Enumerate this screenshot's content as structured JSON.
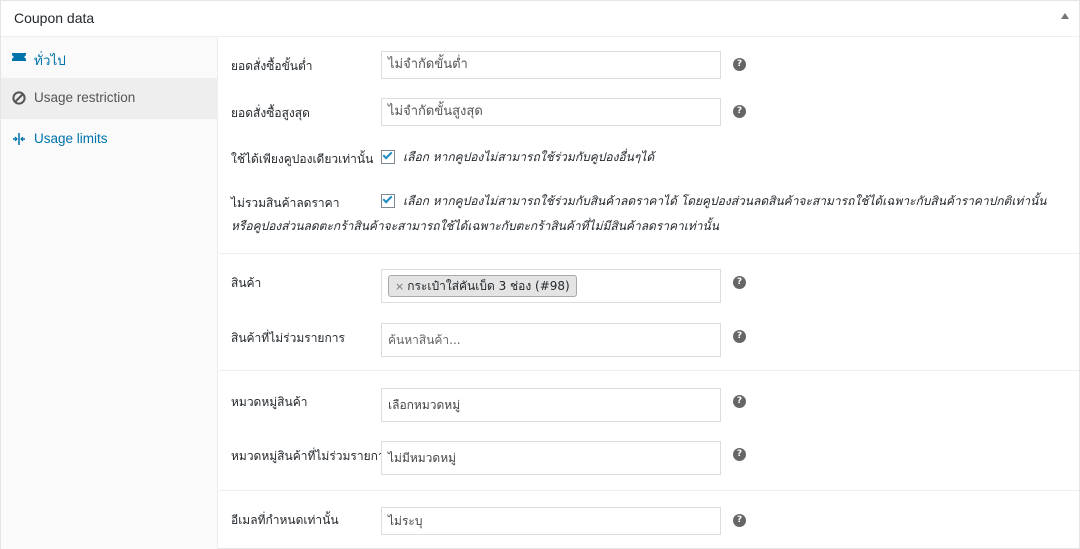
{
  "panel": {
    "title": "Coupon data"
  },
  "tabs": [
    {
      "label": "ทั่วไป",
      "icon": "ticket-icon",
      "active": false
    },
    {
      "label": "Usage restriction",
      "icon": "prohibited-icon",
      "active": true
    },
    {
      "label": "Usage limits",
      "icon": "limits-icon",
      "active": false
    }
  ],
  "fields": {
    "minimum_spend": {
      "label": "ยอดสั่งซื้อขั้นต่ำ",
      "placeholder": "ไม่จำกัดขั้นต่ำ"
    },
    "maximum_spend": {
      "label": "ยอดสั่งซื้อสูงสุด",
      "placeholder": "ไม่จำกัดขั้นสูงสุด"
    },
    "individual_use": {
      "label": "ใช้ได้เพียงคูปองเดียวเท่านั้น",
      "checked": true,
      "description": "เลือก หากคูปองไม่สามารถใช้ร่วมกับคูปองอื่นๆได้"
    },
    "exclude_sale_items": {
      "label": "ไม่รวมสินค้าลดราคา",
      "checked": true,
      "description_line1": "เลือก หากคูปองไม่สามารถใช้ร่วมกับสินค้าลดราคาได้ โดยคูปองส่วนลดสินค้าจะสามารถใช้ได้เฉพาะกับสินค้าราคาปกติเท่านั้น",
      "description_line2": "หรือคูปองส่วนลดตะกร้าสินค้าจะสามารถใช้ได้เฉพาะกับตะกร้าสินค้าที่ไม่มีสินค้าลดราคาเท่านั้น"
    },
    "products": {
      "label": "สินค้า",
      "selected_remove": "×",
      "selected": "กระเป๋าใส่คันเบ็ด 3 ช่อง (#98)"
    },
    "exclude_products": {
      "label": "สินค้าที่ไม่ร่วมรายการ",
      "placeholder": "ค้นหาสินค้า..."
    },
    "product_categories": {
      "label": "หมวดหมู่สินค้า",
      "placeholder": "เลือกหมวดหมู่"
    },
    "exclude_categories": {
      "label": "หมวดหมู่สินค้าที่ไม่ร่วมรายการ",
      "placeholder": "ไม่มีหมวดหมู่"
    },
    "allowed_emails": {
      "label": "อีเมลที่กำหนดเท่านั้น",
      "placeholder": "ไม่ระบุ"
    }
  },
  "help": "?"
}
